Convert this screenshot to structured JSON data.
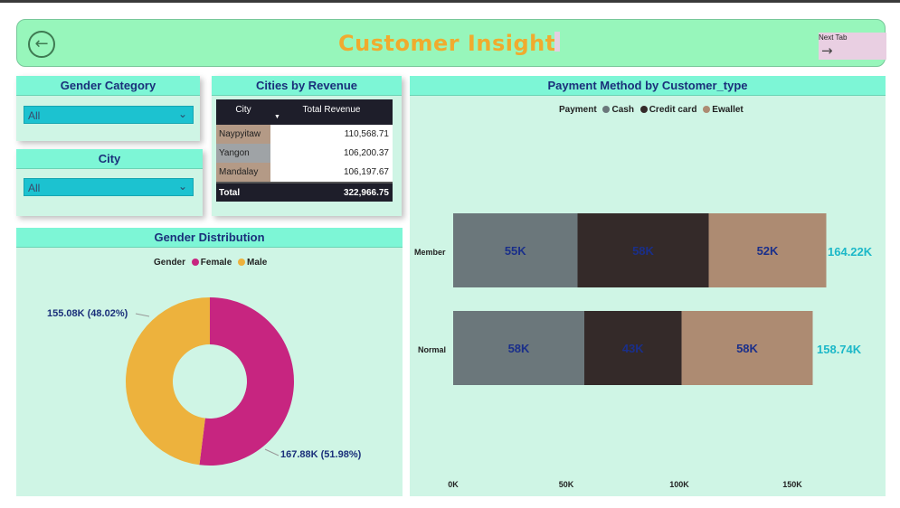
{
  "header": {
    "title": "Customer Insight",
    "next_tab_label": "Next Tab",
    "back_icon": "back-arrow-icon",
    "next_icon": "arrow-right-icon"
  },
  "colors": {
    "accent_title": "#f0ab2e",
    "header_bg": "#97f6bb",
    "panel_bg": "#cff5e5",
    "panel_header": "#7df6d6",
    "female": "#c72580",
    "male": "#edb23d",
    "cash": "#6b777b",
    "credit_card": "#342a29",
    "ewallet": "#ad8b72"
  },
  "gender_category": {
    "title": "Gender Category",
    "selected": "All"
  },
  "city_filter": {
    "title": "City",
    "selected": "All"
  },
  "cities_by_revenue": {
    "title": "Cities by Revenue",
    "columns": [
      "City",
      "Total Revenue"
    ],
    "rows": [
      {
        "city": "Naypyitaw",
        "revenue": "110,568.71",
        "color": "#b49a86"
      },
      {
        "city": "Yangon",
        "revenue": "106,200.37",
        "color": "#9fa3a6"
      },
      {
        "city": "Mandalay",
        "revenue": "106,197.67",
        "color": "#b49a86"
      }
    ],
    "total_label": "Total",
    "total_value": "322,966.75"
  },
  "gender_distribution": {
    "title": "Gender Distribution",
    "legend_title": "Gender",
    "legend": [
      "Female",
      "Male"
    ],
    "label_male": "155.08K (48.02%)",
    "label_female": "167.88K (51.98%)"
  },
  "payment_method": {
    "title": "Payment Method by Customer_type",
    "legend_title": "Payment",
    "legend": [
      "Cash",
      "Credit card",
      "Ewallet"
    ],
    "categories": [
      "Member",
      "Normal"
    ],
    "totals": [
      "164.22K",
      "158.74K"
    ],
    "ticks": [
      "0K",
      "50K",
      "100K",
      "150K"
    ],
    "segment_labels": [
      [
        "55K",
        "58K",
        "52K"
      ],
      [
        "58K",
        "43K",
        "58K"
      ]
    ]
  },
  "chart_data": [
    {
      "type": "pie",
      "title": "Gender Distribution",
      "legend_title": "Gender",
      "categories": [
        "Female",
        "Male"
      ],
      "values": [
        167.88,
        155.08
      ],
      "percent": [
        51.98,
        48.02
      ]
    },
    {
      "type": "bar",
      "orientation": "horizontal",
      "stacked": true,
      "title": "Payment Method by Customer_type",
      "legend_title": "Payment",
      "categories": [
        "Member",
        "Normal"
      ],
      "series": [
        {
          "name": "Cash",
          "values": [
            55,
            58
          ]
        },
        {
          "name": "Credit card",
          "values": [
            58,
            43
          ]
        },
        {
          "name": "Ewallet",
          "values": [
            52,
            58
          ]
        }
      ],
      "totals": [
        164.22,
        158.74
      ],
      "xlim": [
        0,
        150
      ],
      "legend_position": "top"
    }
  ]
}
